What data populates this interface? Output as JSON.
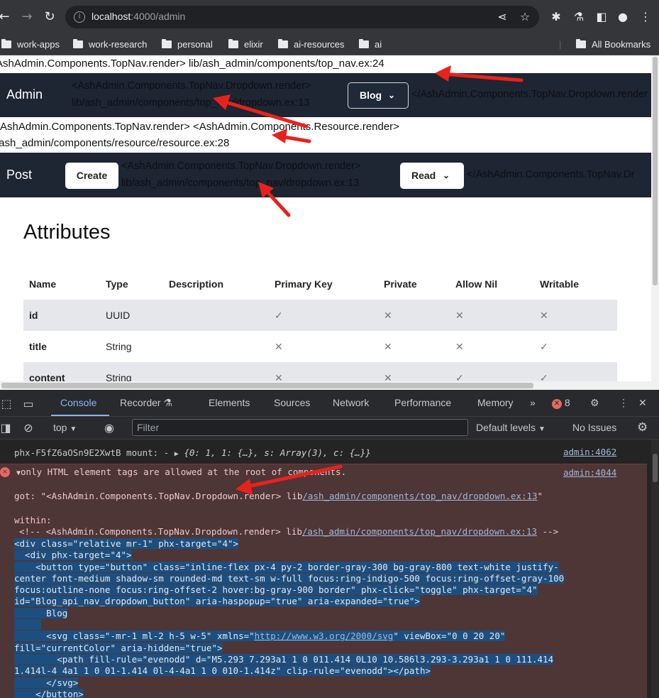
{
  "browser": {
    "url_host": "localhost",
    "url_path": ":4000/admin",
    "bookmarks": [
      "work-apps",
      "work-research",
      "personal",
      "elixir",
      "ai-resources",
      "ai"
    ],
    "all_bookmarks": "All Bookmarks"
  },
  "page": {
    "debug_line1": "AshAdmin.Components.TopNav.render> lib/ash_admin/components/top_nav.ex:24",
    "nav_title": "Admin",
    "nav_debug_l1": "<AshAdmin.Components.TopNav.Dropdown.render>",
    "nav_debug_l2": "lib/ash_admin/components/top_nav/dropdown.ex:13",
    "blog_button": "Blog",
    "nav_debug_close": "</AshAdmin.Components.TopNav.Dropdown.render",
    "debug_line2a": "AshAdmin.Components.TopNav.render> <AshAdmin.Components.Resource.render>",
    "debug_line2b": "/ash_admin/components/resource/resource.ex:28",
    "post_title": "Post",
    "create_button": "Create",
    "post_debug_l1": "<AshAdmin.Components.TopNav.Dropdown.render>",
    "post_debug_l2": "lib/ash_admin/components/top_nav/dropdown.ex:13",
    "read_button": "Read",
    "post_debug_close": "</AshAdmin.Components.TopNav.Dr",
    "attributes_heading": "Attributes",
    "table": {
      "headers": [
        "Name",
        "Type",
        "Description",
        "Primary Key",
        "Private",
        "Allow Nil",
        "Writable"
      ],
      "rows": [
        [
          "id",
          "UUID",
          "",
          "✓",
          "✕",
          "✕",
          "✕"
        ],
        [
          "title",
          "String",
          "",
          "✕",
          "✕",
          "✕",
          "✓"
        ],
        [
          "content",
          "String",
          "",
          "✕",
          "✕",
          "✓",
          "✓"
        ]
      ]
    }
  },
  "devtools": {
    "tabs": [
      "Console",
      "Recorder",
      "Elements",
      "Sources",
      "Network",
      "Performance",
      "Memory"
    ],
    "error_count": "8",
    "context": "top",
    "filter_placeholder": "Filter",
    "levels": "Default levels",
    "issues": "No Issues",
    "log1_text": "phx-F5fZ6aOSn9E2XwtB mount:  -",
    "log1_obj": "{0: 1, 1: {…}, s: Array(3), c: {…}}",
    "log1_src": "admin:4062",
    "err_msg": "only HTML element tags are allowed at the root of components.",
    "err_src": "admin:4044",
    "got_prefix": "got: \"<AshAdmin.Components.TopNav.Dropdown.render> lib",
    "got_link": "/ash_admin/components/top_nav/dropdown.ex:13",
    "got_suffix": "\"",
    "within": "within:",
    "comment_prefix": "<!-- <AshAdmin.Components.TopNav.Dropdown.render> lib",
    "comment_link": "/ash_admin/components/top_nav/dropdown.ex:13",
    "comment_suffix": " -->",
    "code1": "<div class=\"relative mr-1\" phx-target=\"4\">",
    "code2": "  <div phx-target=\"4\">",
    "code3": "    <button type=\"button\" class=\"inline-flex px-4 py-2 border-gray-300 bg-gray-800 text-white justify-",
    "code4": "center font-medium shadow-sm rounded-md text-sm w-full focus:ring-indigo-500 focus:ring-offset-gray-100",
    "code5": "focus:outline-none focus:ring-offset-2 hover:bg-gray-900 border\" phx-click=\"toggle\" phx-target=\"4\"",
    "code6": "id=\"Blog_api_nav_dropdown_button\" aria-haspopup=\"true\" aria-expanded=\"true\">",
    "code7": "      Blog",
    "code8_prefix": "      <svg class=\"-mr-1 ml-2 h-5 w-5\" xmlns=\"",
    "code8_link": "http://www.w3.org/2000/svg",
    "code8_suffix": "\" viewBox=\"0 0 20 20\"",
    "code9": "fill=\"currentColor\" aria-hidden=\"true\">",
    "code10": "        <path fill-rule=\"evenodd\" d=\"M5.293 7.293a1 1 0 011.414 0L10 10.586l3.293-3.293a1 1 0 111.414",
    "code11": "1.414l-4 4a1 1 0 01-1.414 0l-4-4a1 1 0 010-1.414z\" clip-rule=\"evenodd\"></path>",
    "code12": "      </svg>",
    "code13": "    </button>"
  }
}
